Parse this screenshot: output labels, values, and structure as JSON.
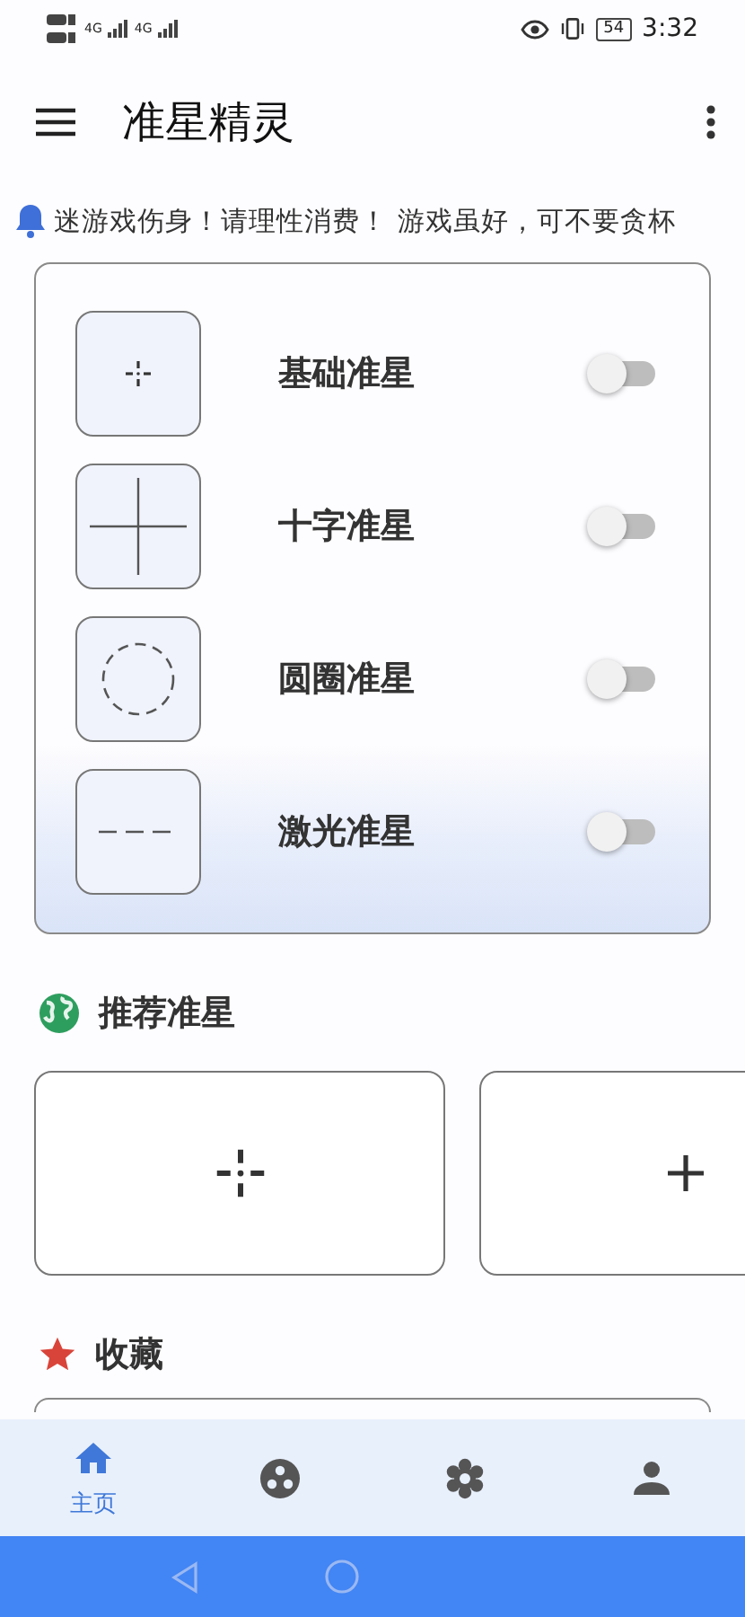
{
  "status_bar": {
    "network": [
      "4G",
      "4G"
    ],
    "battery": "54",
    "time": "3:32"
  },
  "app_bar": {
    "title": "准星精灵"
  },
  "notice": {
    "text": "迷游戏伤身！请理性消费！ 游戏虽好，可不要贪杯"
  },
  "crosshairs": [
    {
      "kind": "dot",
      "label": "基础准星",
      "on": false
    },
    {
      "kind": "cross",
      "label": "十字准星",
      "on": false
    },
    {
      "kind": "circle",
      "label": "圆圈准星",
      "on": false
    },
    {
      "kind": "laser",
      "label": "激光准星",
      "on": false
    }
  ],
  "recommended": {
    "title": "推荐准星",
    "items": [
      {
        "kind": "dot"
      },
      {
        "kind": "plus"
      }
    ]
  },
  "favorites": {
    "title": "收藏"
  },
  "bottom_nav": [
    {
      "kind": "home",
      "label": "主页",
      "selected": true
    },
    {
      "kind": "circles",
      "selected": false
    },
    {
      "kind": "flower",
      "selected": false
    },
    {
      "kind": "person",
      "selected": false
    }
  ]
}
